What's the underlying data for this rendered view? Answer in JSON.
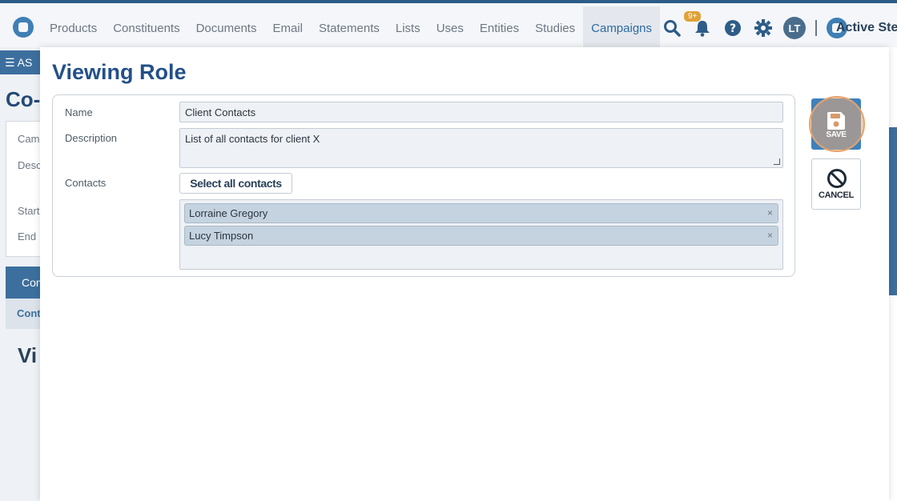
{
  "topnav": {
    "items": [
      "Products",
      "Constituents",
      "Documents",
      "Email",
      "Statements",
      "Lists",
      "Uses",
      "Entities",
      "Studies",
      "Campaigns"
    ],
    "active": "Campaigns",
    "notification_badge": "9+",
    "user_initials": "LT",
    "org_name": "Active Stew"
  },
  "background": {
    "subbar": "AS",
    "heading": "Co-",
    "labels": [
      "Cam",
      "Desc",
      "Start",
      "End"
    ],
    "tab": "Con",
    "subtab": "Cont",
    "heading2": "Vi"
  },
  "modal": {
    "title": "Viewing Role",
    "form": {
      "name_label": "Name",
      "name_value": "Client Contacts",
      "description_label": "Description",
      "description_value": "List of all contacts for client X",
      "contacts_label": "Contacts",
      "select_all_label": "Select all contacts",
      "contacts": [
        "Lorraine Gregory",
        "Lucy Timpson"
      ],
      "remove_glyph": "×"
    },
    "save_label": "SAVE",
    "cancel_label": "CANCEL"
  },
  "colors": {
    "primary": "#3e82bd",
    "title": "#235089",
    "highlight": "#e8a36c"
  }
}
